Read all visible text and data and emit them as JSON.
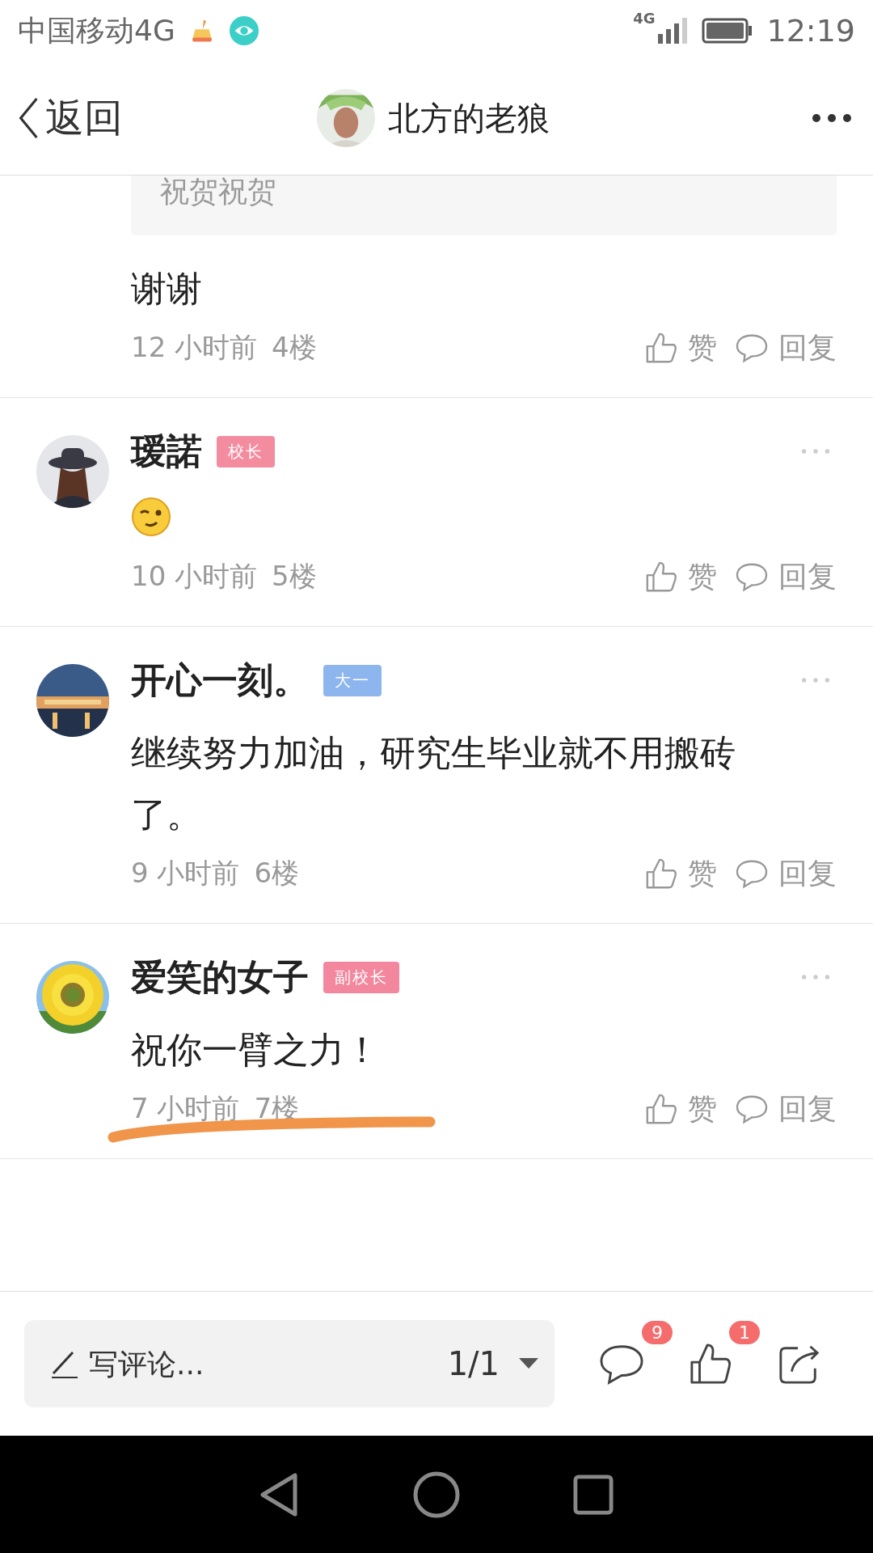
{
  "status_bar": {
    "carrier": "中国移动4G",
    "network": "4G",
    "time": "12:19"
  },
  "header": {
    "back_label": "返回",
    "title": "北方的老狼"
  },
  "comments": [
    {
      "kind": "quoted",
      "quote": "祝贺祝贺",
      "text": "谢谢",
      "time": "12 小时前",
      "floor": "4楼",
      "like_label": "赞",
      "reply_label": "回复",
      "scribbled": false
    },
    {
      "kind": "emoji",
      "name": "瑷諾",
      "badge": {
        "text": "校长",
        "color": "#f48ca0"
      },
      "time": "10 小时前",
      "floor": "5楼",
      "like_label": "赞",
      "reply_label": "回复",
      "scribbled": false
    },
    {
      "kind": "text",
      "name": "开心一刻。",
      "badge": {
        "text": "大一",
        "color": "#8db5ee"
      },
      "text": "继续努力加油，研究生毕业就不用搬砖了。",
      "time": "9 小时前",
      "floor": "6楼",
      "like_label": "赞",
      "reply_label": "回复",
      "scribbled": false
    },
    {
      "kind": "text",
      "name": "爱笑的女子",
      "badge": {
        "text": "副校长",
        "color": "#f2879e"
      },
      "text": "祝你一臂之力！",
      "time": "7 小时前",
      "floor": "7楼",
      "like_label": "赞",
      "reply_label": "回复",
      "scribbled": true
    }
  ],
  "bottom_bar": {
    "placeholder": "写评论...",
    "page": "1/1",
    "comment_count": "9",
    "like_count": "1"
  }
}
